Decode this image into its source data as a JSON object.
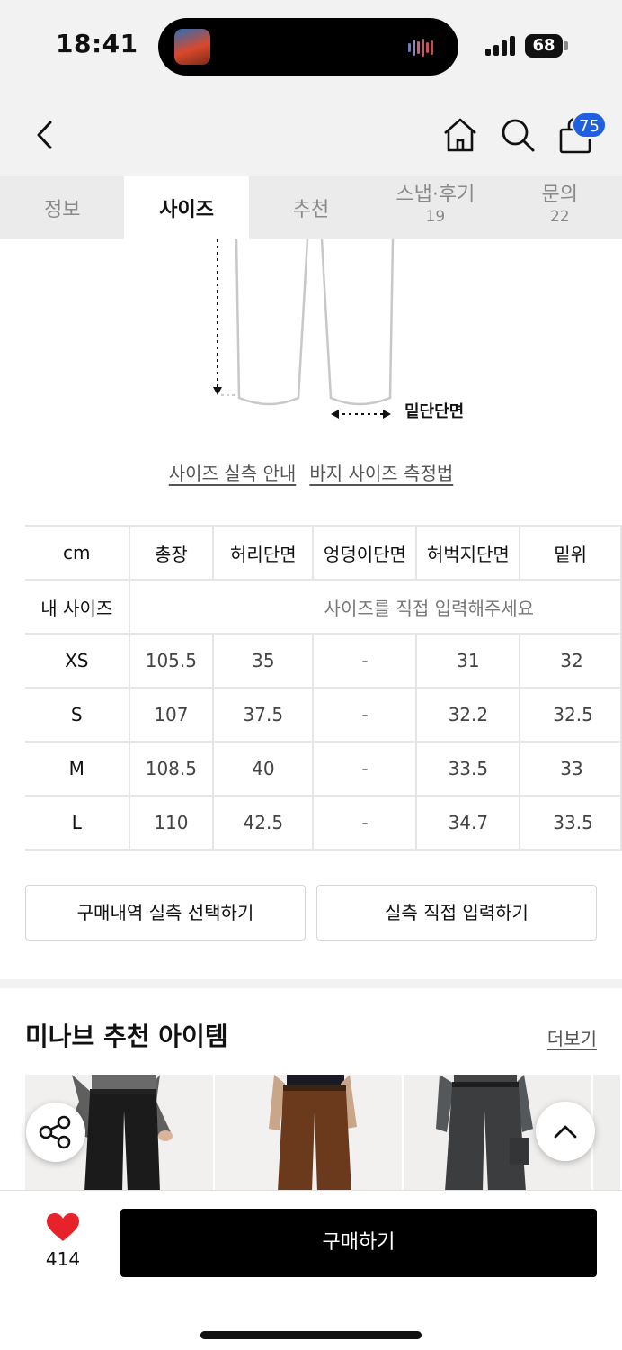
{
  "status": {
    "time": "18:41",
    "battery": "68"
  },
  "header": {
    "cart_count": "75"
  },
  "tabs": [
    {
      "label": "정보",
      "sub": ""
    },
    {
      "label": "사이즈",
      "sub": ""
    },
    {
      "label": "추천",
      "sub": ""
    },
    {
      "label": "스냅·후기",
      "sub": "19"
    },
    {
      "label": "문의",
      "sub": "22"
    }
  ],
  "diagram": {
    "hem_label": "밑단단면"
  },
  "guide_links": {
    "size_guide": "사이즈 실측 안내",
    "measure_guide": "바지 사이즈 측정법"
  },
  "size_table": {
    "columns": [
      "cm",
      "총장",
      "허리단면",
      "엉덩이단면",
      "허벅지단면",
      "밑위"
    ],
    "my_size": {
      "label": "내 사이즈",
      "hint": "사이즈를 직접 입력해주세요"
    },
    "rows": [
      {
        "size": "XS",
        "values": [
          "105.5",
          "35",
          "-",
          "31",
          "32"
        ]
      },
      {
        "size": "S",
        "values": [
          "107",
          "37.5",
          "-",
          "32.2",
          "32.5"
        ]
      },
      {
        "size": "M",
        "values": [
          "108.5",
          "40",
          "-",
          "33.5",
          "33"
        ]
      },
      {
        "size": "L",
        "values": [
          "110",
          "42.5",
          "-",
          "34.7",
          "33.5"
        ]
      }
    ]
  },
  "actions": {
    "history_select": "구매내역 실측 선택하기",
    "direct_input": "실측 직접 입력하기"
  },
  "recommend": {
    "title": "미나브 추천 아이템",
    "more": "더보기"
  },
  "bottom": {
    "likes": "414",
    "buy": "구매하기"
  },
  "colors": {
    "accent_badge": "#1f5fe0",
    "heart": "#e8222b",
    "buy_button": "#000000"
  }
}
